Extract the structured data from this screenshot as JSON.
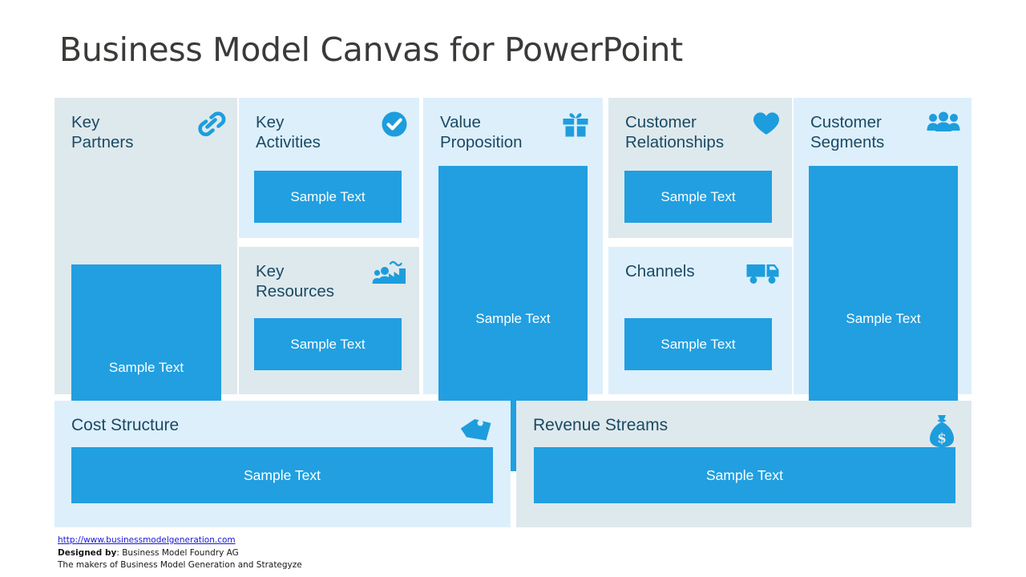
{
  "slide": {
    "title": "Business Model Canvas for PowerPoint",
    "background_color": "#ffffff",
    "accent_color": "#219fe0",
    "panel_grey_color": "#dee9ed",
    "panel_blue_color": "#ddeffb",
    "heading_color": "#1a4a63",
    "title_color": "#3a3a38"
  },
  "panels": [
    {
      "id": "key-partners",
      "title": "Key\nPartners",
      "icon": "chain-link-icon",
      "sample_text": "Sample Text",
      "shade": "grey"
    },
    {
      "id": "key-activities",
      "title": "Key\nActivities",
      "icon": "check-circle-icon",
      "sample_text": "Sample Text",
      "shade": "blue"
    },
    {
      "id": "key-resources",
      "title": "Key\nResources",
      "icon": "factory-people-icon",
      "sample_text": "Sample Text",
      "shade": "grey"
    },
    {
      "id": "value-proposition",
      "title": "Value\nProposition",
      "icon": "gift-box-icon",
      "sample_text": "Sample Text",
      "shade": "blue"
    },
    {
      "id": "customer-relationships",
      "title": "Customer\nRelationships",
      "icon": "heart-icon",
      "sample_text": "Sample Text",
      "shade": "grey"
    },
    {
      "id": "channels",
      "title": "Channels",
      "icon": "delivery-truck-icon",
      "sample_text": "Sample Text",
      "shade": "blue"
    },
    {
      "id": "customer-segments",
      "title": "Customer\nSegments",
      "icon": "people-group-icon",
      "sample_text": "Sample Text",
      "shade": "blue"
    },
    {
      "id": "cost-structure",
      "title": "Cost Structure",
      "icon": "price-tag-icon",
      "sample_text": "Sample Text",
      "shade": "blue"
    },
    {
      "id": "revenue-streams",
      "title": "Revenue Streams",
      "icon": "money-bag-icon",
      "sample_text": "Sample Text",
      "shade": "grey"
    }
  ],
  "footer": {
    "url": "http://www.businessmodelgeneration.com",
    "designed_by_label": "Designed by",
    "designed_by_value": ": Business Model Foundry AG",
    "tagline": "The makers of Business Model Generation and Strategyze"
  }
}
